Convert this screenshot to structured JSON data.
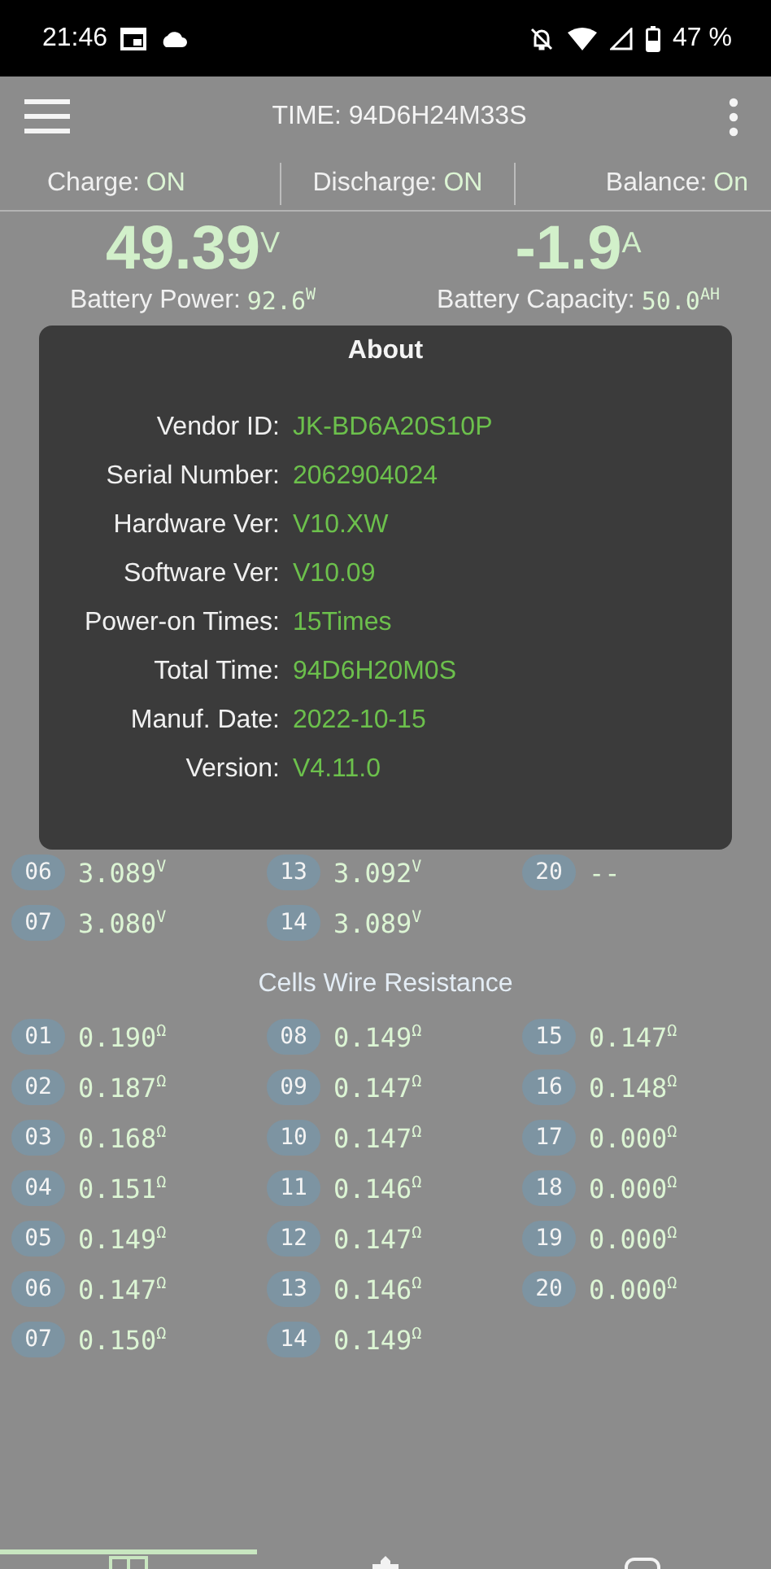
{
  "status_bar": {
    "time": "21:46",
    "battery": "47 %"
  },
  "app_bar": {
    "title": "TIME: 94D6H24M33S"
  },
  "switches": [
    {
      "label": "Charge:",
      "value": "ON"
    },
    {
      "label": "Discharge:",
      "value": "ON"
    },
    {
      "label": "Balance:",
      "value": "On"
    }
  ],
  "readings": [
    {
      "value": "49.39",
      "unit": "V",
      "label": "Battery Power:",
      "detail": "92.6",
      "detail_unit": "W"
    },
    {
      "value": "-1.9",
      "unit": "A",
      "label": "Battery Capacity:",
      "detail": "50.0",
      "detail_unit": "AH"
    }
  ],
  "cells_voltage": {
    "cells": [
      {
        "index": "06",
        "value": "3.089$^{V}$"
      },
      {
        "index": "07",
        "value": "3.080$^{V}$"
      },
      {
        "index": "13",
        "value": "3.092$^{V}$"
      },
      {
        "index": "14",
        "value": "3.089$^{V}$"
      },
      {
        "index": "20",
        "value": "--"
      }
    ]
  },
  "cells_wire_resistance": {
    "title": "Cells Wire Resistance",
    "cells": [
      {
        "index": "01",
        "value": "0.190$^{Ω}$"
      },
      {
        "index": "02",
        "value": "0.187$^{Ω}$"
      },
      {
        "index": "03",
        "value": "0.168$^{Ω}$"
      },
      {
        "index": "04",
        "value": "0.151$^{Ω}$"
      },
      {
        "index": "05",
        "value": "0.149$^{Ω}$"
      },
      {
        "index": "06",
        "value": "0.147$^{Ω}$"
      },
      {
        "index": "07",
        "value": "0.150$^{Ω}$"
      },
      {
        "index": "08",
        "value": "0.149$^{Ω}$"
      },
      {
        "index": "09",
        "value": "0.147$^{Ω}$"
      },
      {
        "index": "10",
        "value": "0.147$^{Ω}$"
      },
      {
        "index": "11",
        "value": "0.146$^{Ω}$"
      },
      {
        "index": "12",
        "value": "0.147$^{Ω}$"
      },
      {
        "index": "13",
        "value": "0.146$^{Ω}$"
      },
      {
        "index": "14",
        "value": "0.149$^{Ω}$"
      },
      {
        "index": "15",
        "value": "0.147$^{Ω}$"
      },
      {
        "index": "16",
        "value": "0.148$^{Ω}$"
      },
      {
        "index": "17",
        "value": "0.000$^{Ω}$"
      },
      {
        "index": "18",
        "value": "0.000$^{Ω}$"
      },
      {
        "index": "19",
        "value": "0.000$^{Ω}$"
      },
      {
        "index": "20",
        "value": "0.000$^{Ω}$"
      }
    ]
  },
  "bottom_tabs": [
    {
      "selected": true
    },
    {
      "selected": false
    },
    {
      "selected": false
    }
  ],
  "about_dialog": {
    "title": "About",
    "rows": [
      {
        "label": "Vendor ID:",
        "value": "JK-BD6A20S10P"
      },
      {
        "label": "Serial Number:",
        "value": "2062904024"
      },
      {
        "label": "Hardware Ver:",
        "value": "V10.XW"
      },
      {
        "label": "Software Ver:",
        "value": "V10.09"
      },
      {
        "label": "Power-on Times:",
        "value": "15Times"
      },
      {
        "label": "Total Time:",
        "value": "94D6H20M0S"
      },
      {
        "label": "Manuf. Date:",
        "value": "2022-10-15"
      },
      {
        "label": "Version:",
        "value": "V4.11.0"
      }
    ]
  }
}
